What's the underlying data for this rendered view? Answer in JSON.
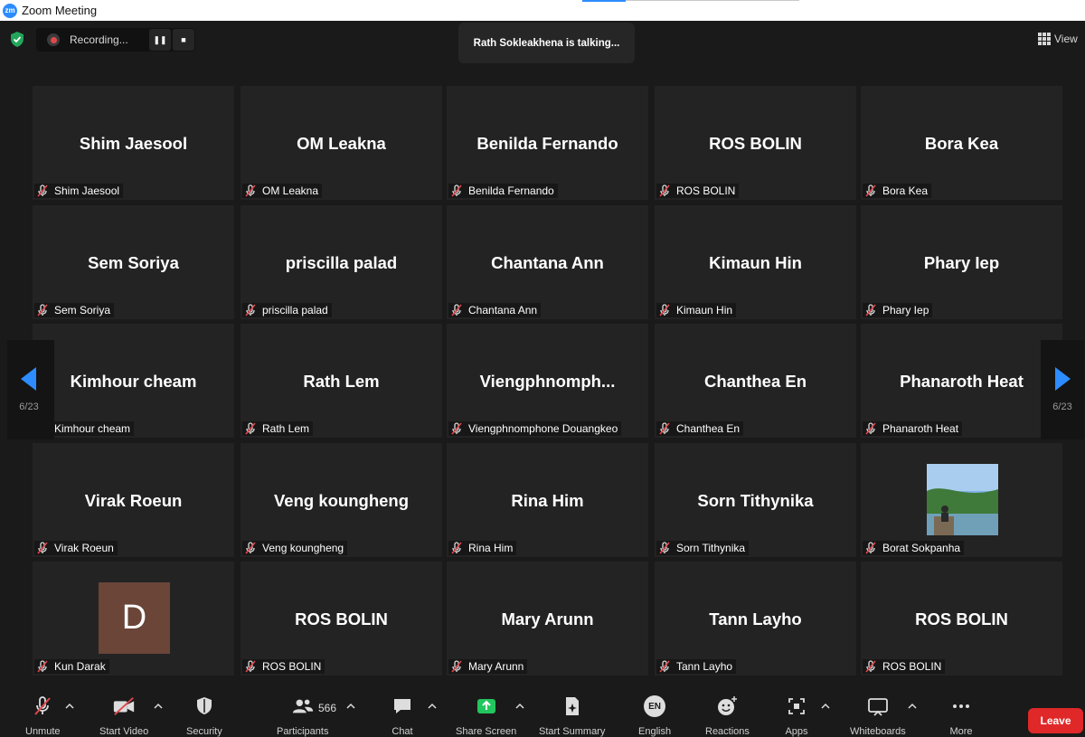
{
  "window": {
    "title": "Zoom Meeting",
    "logo": "zm"
  },
  "recording": {
    "label": "Recording..."
  },
  "talking": "Rath Sokleakhena is talking...",
  "view": {
    "label": "View"
  },
  "pager": {
    "left": "6/23",
    "right": "6/23"
  },
  "participants": [
    {
      "big": "Shim Jaesool",
      "label": "Shim Jaesool"
    },
    {
      "big": "OM Leakna",
      "label": "OM Leakna"
    },
    {
      "big": "Benilda Fernando",
      "label": "Benilda Fernando"
    },
    {
      "big": "ROS BOLIN",
      "label": "ROS BOLIN"
    },
    {
      "big": "Bora Kea",
      "label": "Bora Kea"
    },
    {
      "big": "Sem Soriya",
      "label": "Sem Soriya"
    },
    {
      "big": "priscilla palad",
      "label": "priscilla palad"
    },
    {
      "big": "Chantana Ann",
      "label": "Chantana Ann"
    },
    {
      "big": "Kimaun Hin",
      "label": "Kimaun Hin"
    },
    {
      "big": "Phary Iep",
      "label": "Phary Iep"
    },
    {
      "big": "Kimhour cheam",
      "label": "Kimhour cheam"
    },
    {
      "big": "Rath Lem",
      "label": "Rath Lem"
    },
    {
      "big": "Viengphnomph...",
      "label": "Viengphnomphone Douangkeo"
    },
    {
      "big": "Chanthea En",
      "label": "Chanthea En"
    },
    {
      "big": "Phanaroth Heat",
      "label": "Phanaroth Heat"
    },
    {
      "big": "Virak Roeun",
      "label": "Virak Roeun"
    },
    {
      "big": "Veng koungheng",
      "label": "Veng koungheng"
    },
    {
      "big": "Rina Him",
      "label": "Rina Him"
    },
    {
      "big": "Sorn Tithynika",
      "label": "Sorn Tithynika"
    },
    {
      "big": "",
      "label": "Borat Sokpanha",
      "photo": true
    },
    {
      "big": "",
      "label": "Kun Darak",
      "initial": "D"
    },
    {
      "big": "ROS BOLIN",
      "label": "ROS BOLIN"
    },
    {
      "big": "Mary Arunn",
      "label": "Mary Arunn"
    },
    {
      "big": "Tann Layho",
      "label": "Tann Layho"
    },
    {
      "big": "ROS BOLIN",
      "label": "ROS BOLIN"
    }
  ],
  "toolbar": {
    "unmute": "Unmute",
    "start_video": "Start Video",
    "security": "Security",
    "participants": "Participants",
    "participant_count": "566",
    "chat": "Chat",
    "share_screen": "Share Screen",
    "start_summary": "Start Summary",
    "english": "English",
    "english_badge": "EN",
    "reactions": "Reactions",
    "apps": "Apps",
    "whiteboards": "Whiteboards",
    "more": "More",
    "leave": "Leave"
  },
  "colors": {
    "accent": "#2d8cff",
    "leave": "#e02828",
    "share": "#22c55e",
    "muted": "#e0474c"
  }
}
